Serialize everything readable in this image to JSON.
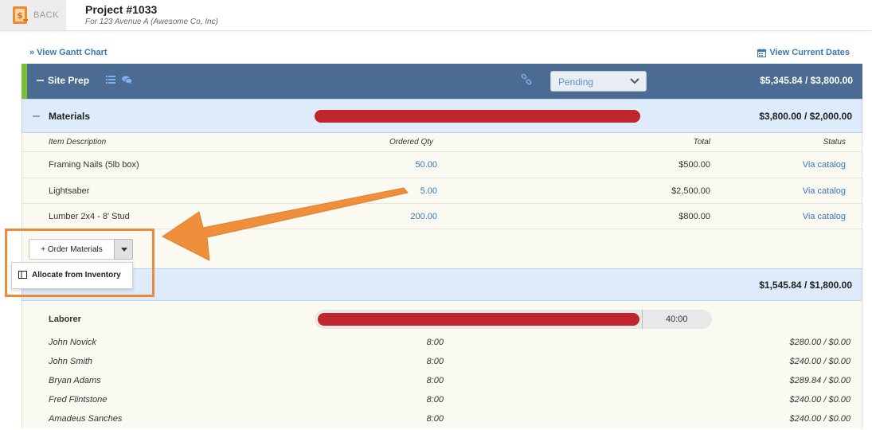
{
  "header": {
    "back_label": "BACK",
    "project_title": "Project #1033",
    "project_subtitle": "For 123 Avenue A (Awesome Co, Inc)"
  },
  "links": {
    "gantt": "» View Gantt Chart",
    "current_dates": "View Current Dates"
  },
  "site_prep": {
    "title": "Site Prep",
    "status": "Pending",
    "total": "$5,345.84 / $3,800.00",
    "accent_color": "#7bbf36"
  },
  "materials": {
    "title": "Materials",
    "total": "$3,800.00 / $2,000.00",
    "columns": {
      "description": "Item Description",
      "qty": "Ordered Qty",
      "total": "Total",
      "status": "Status"
    },
    "rows": [
      {
        "description": "Framing Nails (5lb box)",
        "qty": "50.00",
        "total": "$500.00",
        "status": "Via catalog"
      },
      {
        "description": "Lightsaber",
        "qty": "5.00",
        "total": "$2,500.00",
        "status": "Via catalog"
      },
      {
        "description": "Lumber 2x4 - 8' Stud",
        "qty": "200.00",
        "total": "$800.00",
        "status": "Via catalog"
      }
    ],
    "order_button": "+ Order Materials",
    "dropdown_item": "Allocate from Inventory"
  },
  "labor": {
    "total": "$1,545.84 / $1,800.00",
    "laborer_label": "Laborer",
    "hours_total": "40:00",
    "rows": [
      {
        "name": "John Novick",
        "hours": "8:00",
        "cost": "$280.00 / $0.00"
      },
      {
        "name": "John Smith",
        "hours": "8:00",
        "cost": "$240.00 / $0.00"
      },
      {
        "name": "Bryan Adams",
        "hours": "8:00",
        "cost": "$289.84 / $0.00"
      },
      {
        "name": "Fred Flintstone",
        "hours": "8:00",
        "cost": "$240.00 / $0.00"
      },
      {
        "name": "Amadeus Sanches",
        "hours": "8:00",
        "cost": "$240.00 / $0.00"
      }
    ]
  },
  "colors": {
    "header_blue": "#4b6b92",
    "section_light_blue": "#ddebfa",
    "progress_red": "#c0262c",
    "link_blue": "#3a78b5",
    "highlight_orange": "#ed8a3a"
  },
  "icons": [
    "document-dollar-icon",
    "list-icon",
    "chat-icon",
    "link-icon",
    "calendar-icon",
    "chevron-down-icon",
    "caret-down-icon",
    "inventory-icon",
    "arrow-annotation"
  ]
}
